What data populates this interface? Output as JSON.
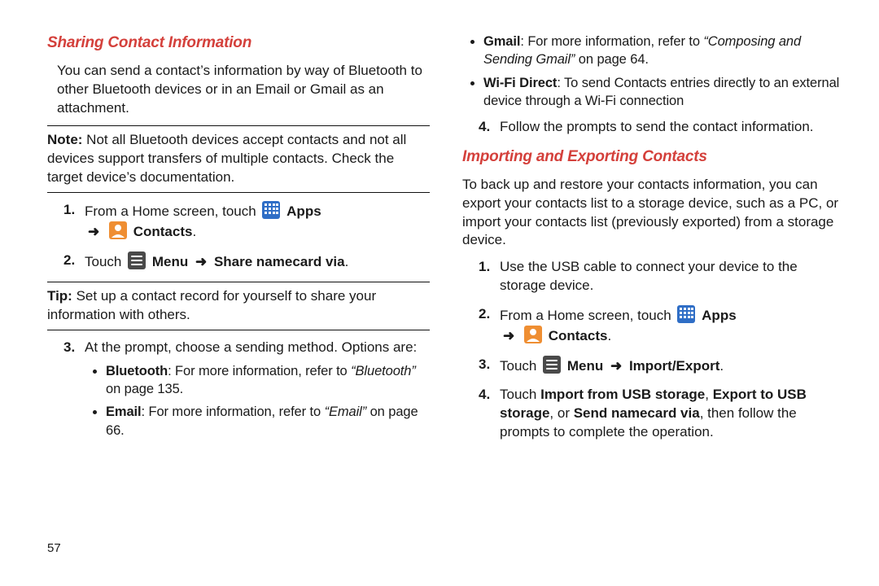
{
  "pageNumber": "57",
  "arrowGlyph": "➜",
  "left": {
    "heading": "Sharing Contact Information",
    "intro": "You can send a contact’s information by way of Bluetooth to other Bluetooth devices or in an Email or Gmail as an attachment.",
    "noteLabel": "Note:",
    "noteBody": " Not all Bluetooth devices accept contacts and not all devices support transfers of multiple contacts. Check the target device’s documentation.",
    "step1_a": "From a Home screen, touch ",
    "appsLabel": "Apps",
    "contactsLabel": "Contacts",
    "step2_a": "Touch ",
    "menuLabel": "Menu",
    "shareLabel": "Share namecard via",
    "tipLabel": "Tip:",
    "tipBody": " Set up a contact record for yourself to share your information with others.",
    "step3_a": "At the prompt, choose a sending method. Options are:",
    "bt_label": "Bluetooth",
    "bt_tail1": ": For more information, refer to ",
    "bt_ref": "“Bluetooth”",
    "bt_tail2": " on page 135.",
    "email_label": "Email",
    "email_tail1": ": For more information, refer to ",
    "email_ref": "“Email”",
    "email_tail2": " on page 66."
  },
  "right": {
    "gmail_label": "Gmail",
    "gmail_tail1": ": For more information, refer to ",
    "gmail_ref": "“Composing and Sending Gmail”",
    "gmail_tail2": " on page 64.",
    "wifi_label": "Wi-Fi Direct",
    "wifi_tail": ": To send Contacts entries directly to an external device through a Wi-Fi connection",
    "step4": "Follow the prompts to send the contact information.",
    "heading2": "Importing and Exporting Contacts",
    "intro2": "To back up and restore your contacts information, you can export your contacts list to a storage device, such as a PC, or import your contacts list (previously exported) from a storage device.",
    "imp_step1": "Use the USB cable to connect your device to the storage device.",
    "imp_step2_a": "From a Home screen, touch ",
    "appsLabel": "Apps",
    "contactsLabel": "Contacts",
    "imp_step3_a": "Touch ",
    "menuLabel": "Menu",
    "impExpLabel": "Import/Export",
    "imp_step4_a": "Touch ",
    "importUSB": "Import from USB storage",
    "comma": ", ",
    "exportUSB": "Export to USB storage",
    "or": ", or ",
    "sendNamecard": "Send namecard via",
    "imp_step4_b": ", then follow the prompts to complete the operation."
  }
}
